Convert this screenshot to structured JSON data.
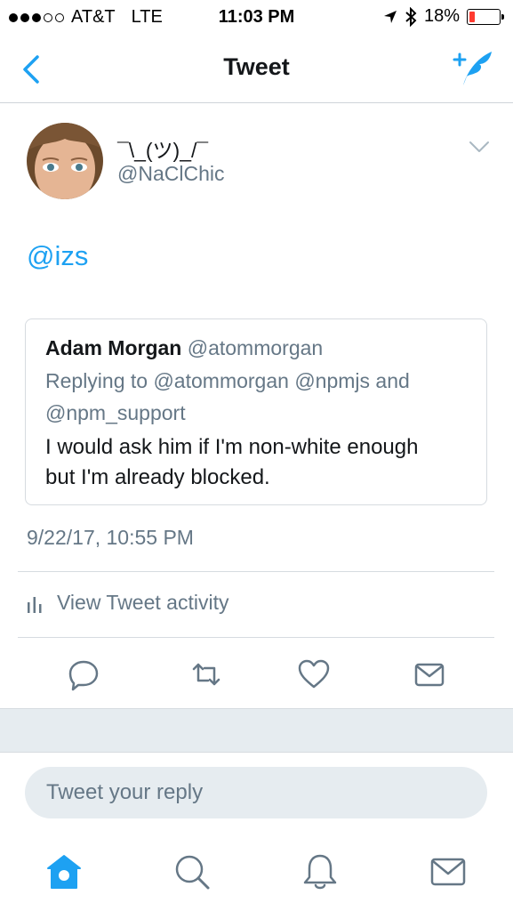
{
  "status_bar": {
    "carrier": "AT&T",
    "network": "LTE",
    "time": "11:03 PM",
    "battery": "18%",
    "battery_level": 0.18,
    "battery_color": "#ff3b30"
  },
  "nav": {
    "title": "Tweet",
    "back_icon": "chevron-left-icon",
    "compose_icon": "compose-tweet-icon"
  },
  "tweet": {
    "display_name": "¯\\_(ツ)_/¯",
    "handle": "@NaClChic",
    "text": "@izs",
    "timestamp": "9/22/17, 10:55 PM",
    "quoted": {
      "name": "Adam Morgan",
      "handle": "@atommorgan",
      "reply_line1": "Replying to @atommorgan @npmjs and",
      "reply_line2": "@npm_support",
      "text_line1": "I would ask him if I'm non-white enough",
      "text_line2": "but I'm already blocked."
    }
  },
  "activity": {
    "label": "View Tweet activity"
  },
  "actions": [
    "reply-icon",
    "retweet-icon",
    "like-icon",
    "dm-icon"
  ],
  "reply_box": {
    "placeholder": "Tweet your reply"
  },
  "tab_bar": [
    "home-icon",
    "search-icon",
    "notifications-icon",
    "messages-icon"
  ],
  "colors": {
    "accent": "#1da1f2",
    "secondary_text": "#657786",
    "divider": "#d6dbe0"
  }
}
